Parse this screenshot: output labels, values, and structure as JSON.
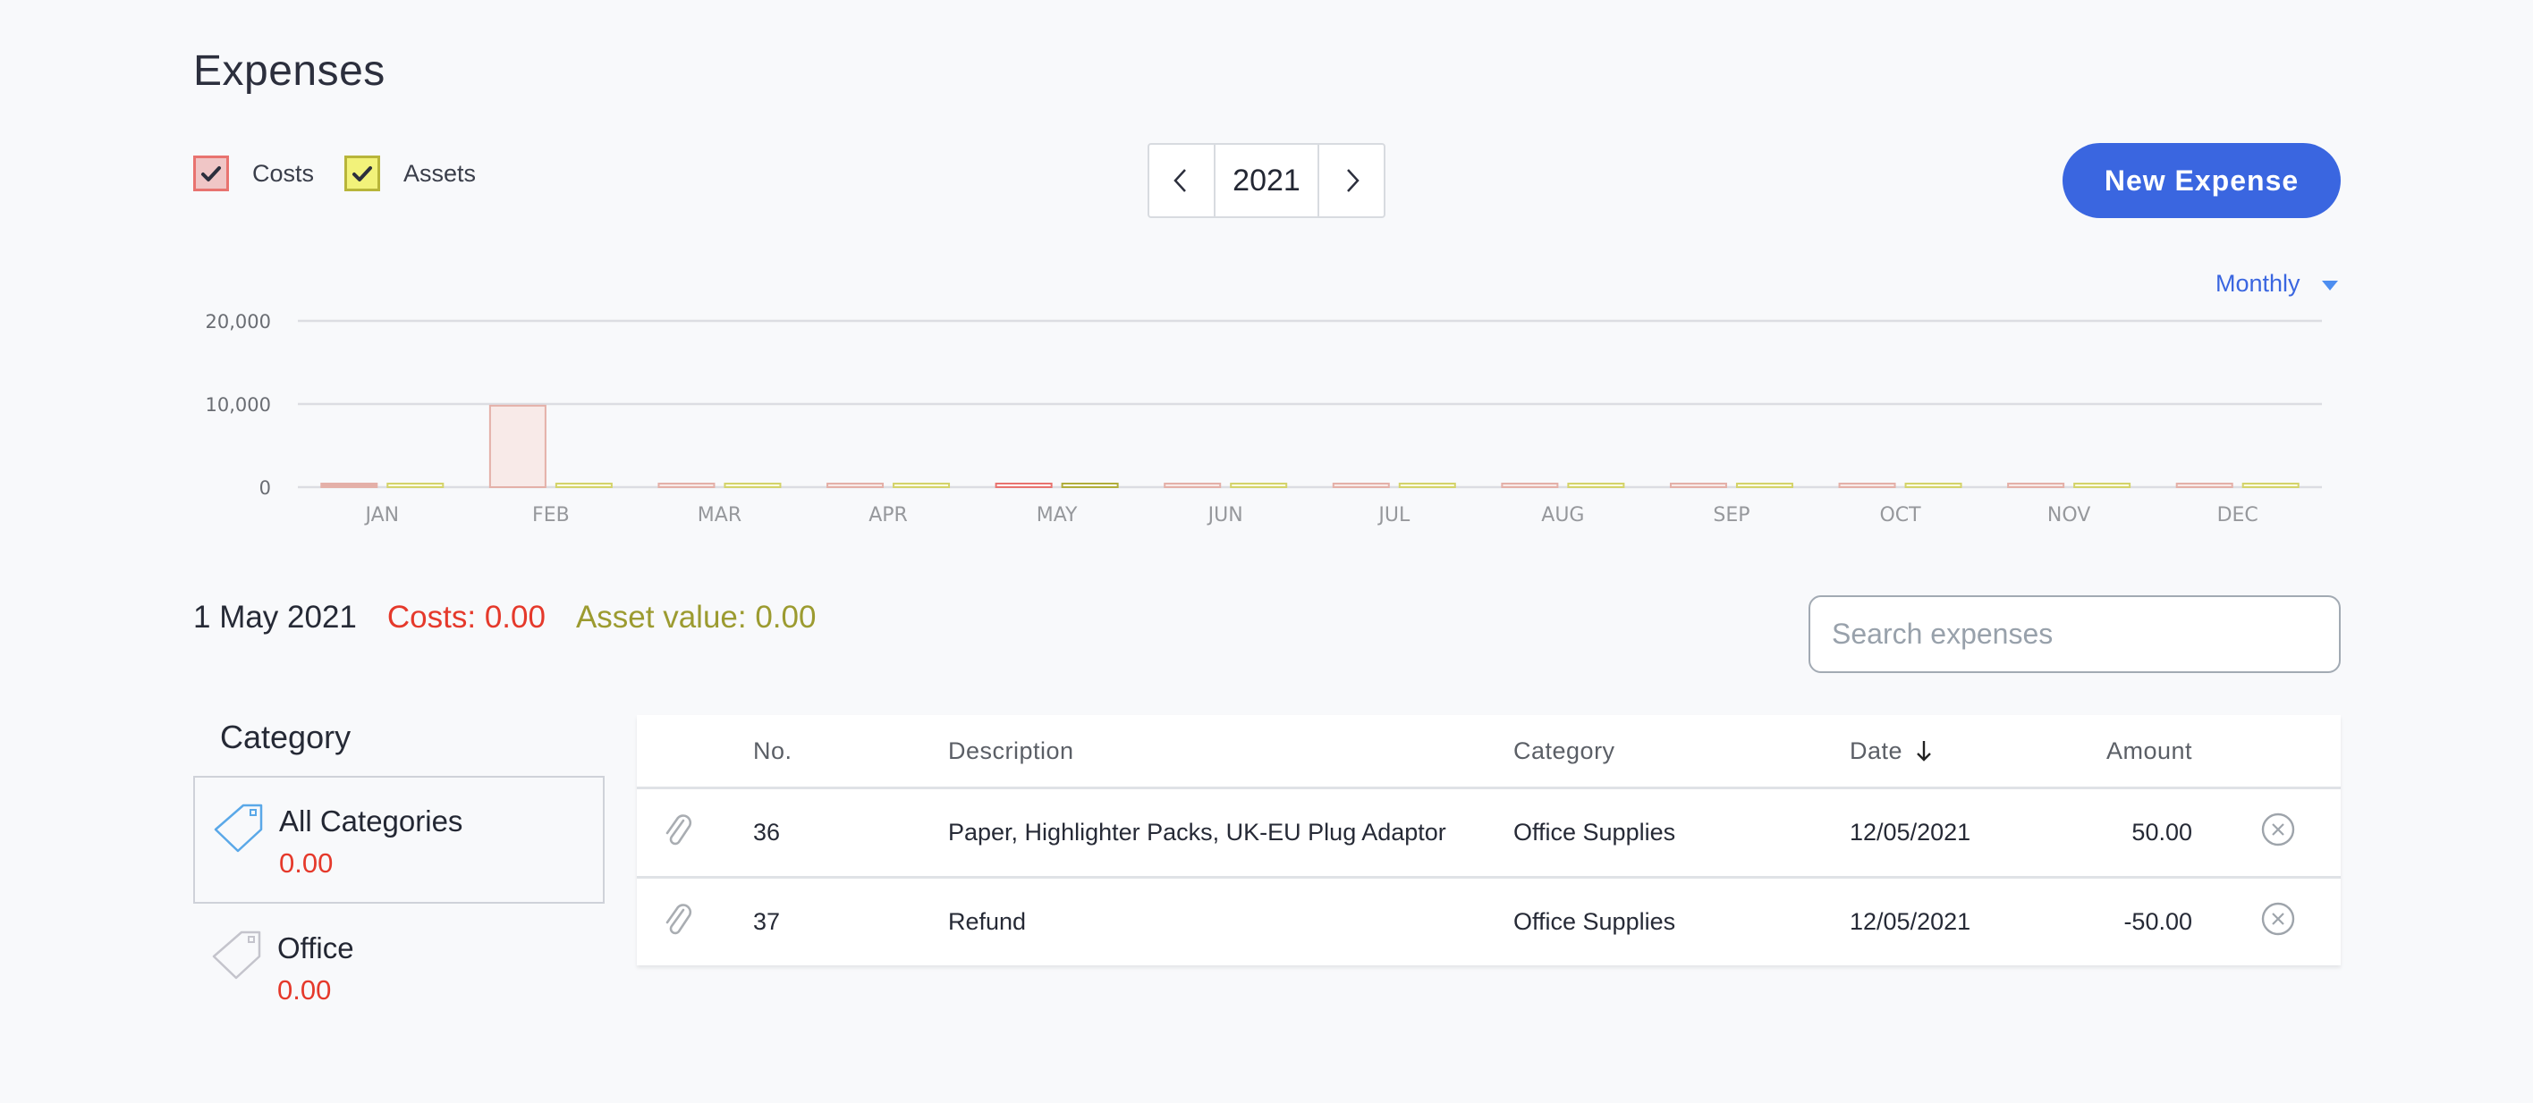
{
  "page": {
    "title": "Expenses"
  },
  "legend": {
    "costs": {
      "label": "Costs",
      "checked": true,
      "color": "#e8736f",
      "fill": "#f0c6c6"
    },
    "assets": {
      "label": "Assets",
      "checked": true,
      "color": "#b8b53a",
      "fill": "#f2f27a"
    }
  },
  "year_selector": {
    "year": "2021",
    "prev_icon": "chevron-left-icon",
    "next_icon": "chevron-right-icon"
  },
  "toolbar": {
    "new_expense_label": "New Expense"
  },
  "period": {
    "selected": "Monthly"
  },
  "chart_data": {
    "type": "bar",
    "title": "",
    "xlabel": "",
    "ylabel": "",
    "ylim": [
      0,
      20000
    ],
    "yticks": [
      "0",
      "10,000",
      "20,000"
    ],
    "ytick_values": [
      0,
      10000,
      20000
    ],
    "grid": true,
    "categories": [
      "JAN",
      "FEB",
      "MAR",
      "APR",
      "MAY",
      "JUN",
      "JUL",
      "AUG",
      "SEP",
      "OCT",
      "NOV",
      "DEC"
    ],
    "selected_category": "MAY",
    "series": [
      {
        "name": "Costs",
        "stroke": "#e4b0a8",
        "fill": "#f8eae8",
        "selected_stroke": "#e8736f",
        "values": [
          300,
          9800,
          0,
          0,
          0,
          0,
          0,
          0,
          0,
          0,
          0,
          0
        ]
      },
      {
        "name": "Assets",
        "stroke": "#d4d36a",
        "fill": "#fbfbe2",
        "selected_stroke": "#b0ad3a",
        "values": [
          0,
          0,
          0,
          0,
          0,
          0,
          0,
          0,
          0,
          0,
          0,
          0
        ]
      }
    ]
  },
  "summary": {
    "date": "1 May 2021",
    "costs": "Costs: 0.00",
    "asset_value": "Asset value: 0.00"
  },
  "search": {
    "placeholder": "Search expenses",
    "value": ""
  },
  "categories": {
    "heading": "Category",
    "items": [
      {
        "name": "All Categories",
        "value": "0.00",
        "selected": true
      },
      {
        "name": "Office",
        "value": "0.00",
        "selected": false
      }
    ]
  },
  "table": {
    "columns": [
      "",
      "No.",
      "Description",
      "Category",
      "Date",
      "Amount",
      ""
    ],
    "sort": {
      "column": "Date",
      "direction": "desc"
    },
    "rows": [
      {
        "no": "36",
        "description": "Paper, Highlighter Packs, UK-EU Plug Adaptor",
        "category": "Office Supplies",
        "date": "12/05/2021",
        "amount": "50.00"
      },
      {
        "no": "37",
        "description": "Refund",
        "category": "Office Supplies",
        "date": "12/05/2021",
        "amount": "-50.00"
      }
    ]
  }
}
